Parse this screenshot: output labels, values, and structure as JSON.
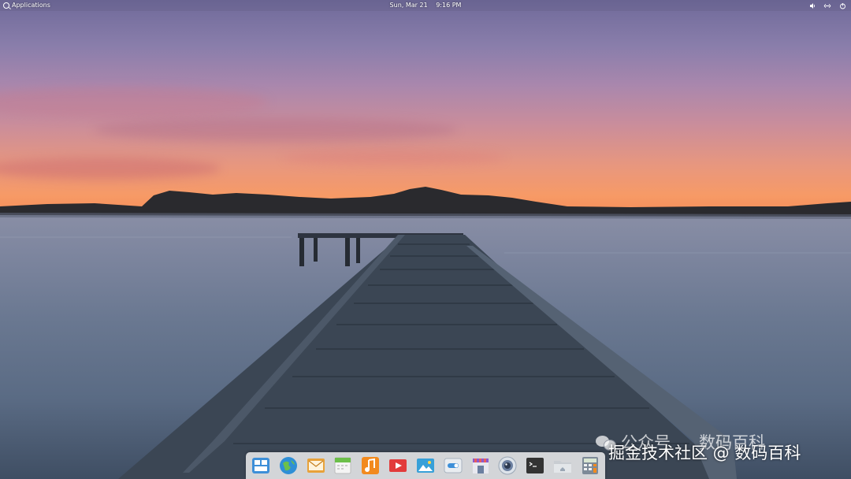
{
  "top_panel": {
    "applications_label": "Applications",
    "date": "Sun, Mar 21",
    "time": "9:16 PM",
    "indicators": [
      "volume-icon",
      "network-icon",
      "power-icon"
    ]
  },
  "dock": {
    "apps": [
      {
        "name": "multitasking-view-icon",
        "color": "#3d8fd8"
      },
      {
        "name": "web-browser-icon",
        "color": "#2f8fd6"
      },
      {
        "name": "mail-icon",
        "color": "#e8a23a"
      },
      {
        "name": "calendar-icon",
        "color": "#6cbf4a"
      },
      {
        "name": "music-icon",
        "color": "#f28a1e"
      },
      {
        "name": "videos-icon",
        "color": "#e23b3b"
      },
      {
        "name": "photos-icon",
        "color": "#37a0d8"
      },
      {
        "name": "settings-icon",
        "color": "#9aa8b8"
      },
      {
        "name": "appcenter-icon",
        "color": "#8a5bd0"
      },
      {
        "name": "camera-icon",
        "color": "#6b7fa0"
      },
      {
        "name": "terminal-icon",
        "color": "#333333"
      },
      {
        "name": "files-icon",
        "color": "#c9cdd2"
      },
      {
        "name": "calculator-icon",
        "color": "#7d8a98"
      }
    ]
  },
  "watermark": {
    "line1_left": "公众号",
    "line1_right": "数码百科",
    "line2": "掘金技术社区 @ 数码百科"
  }
}
